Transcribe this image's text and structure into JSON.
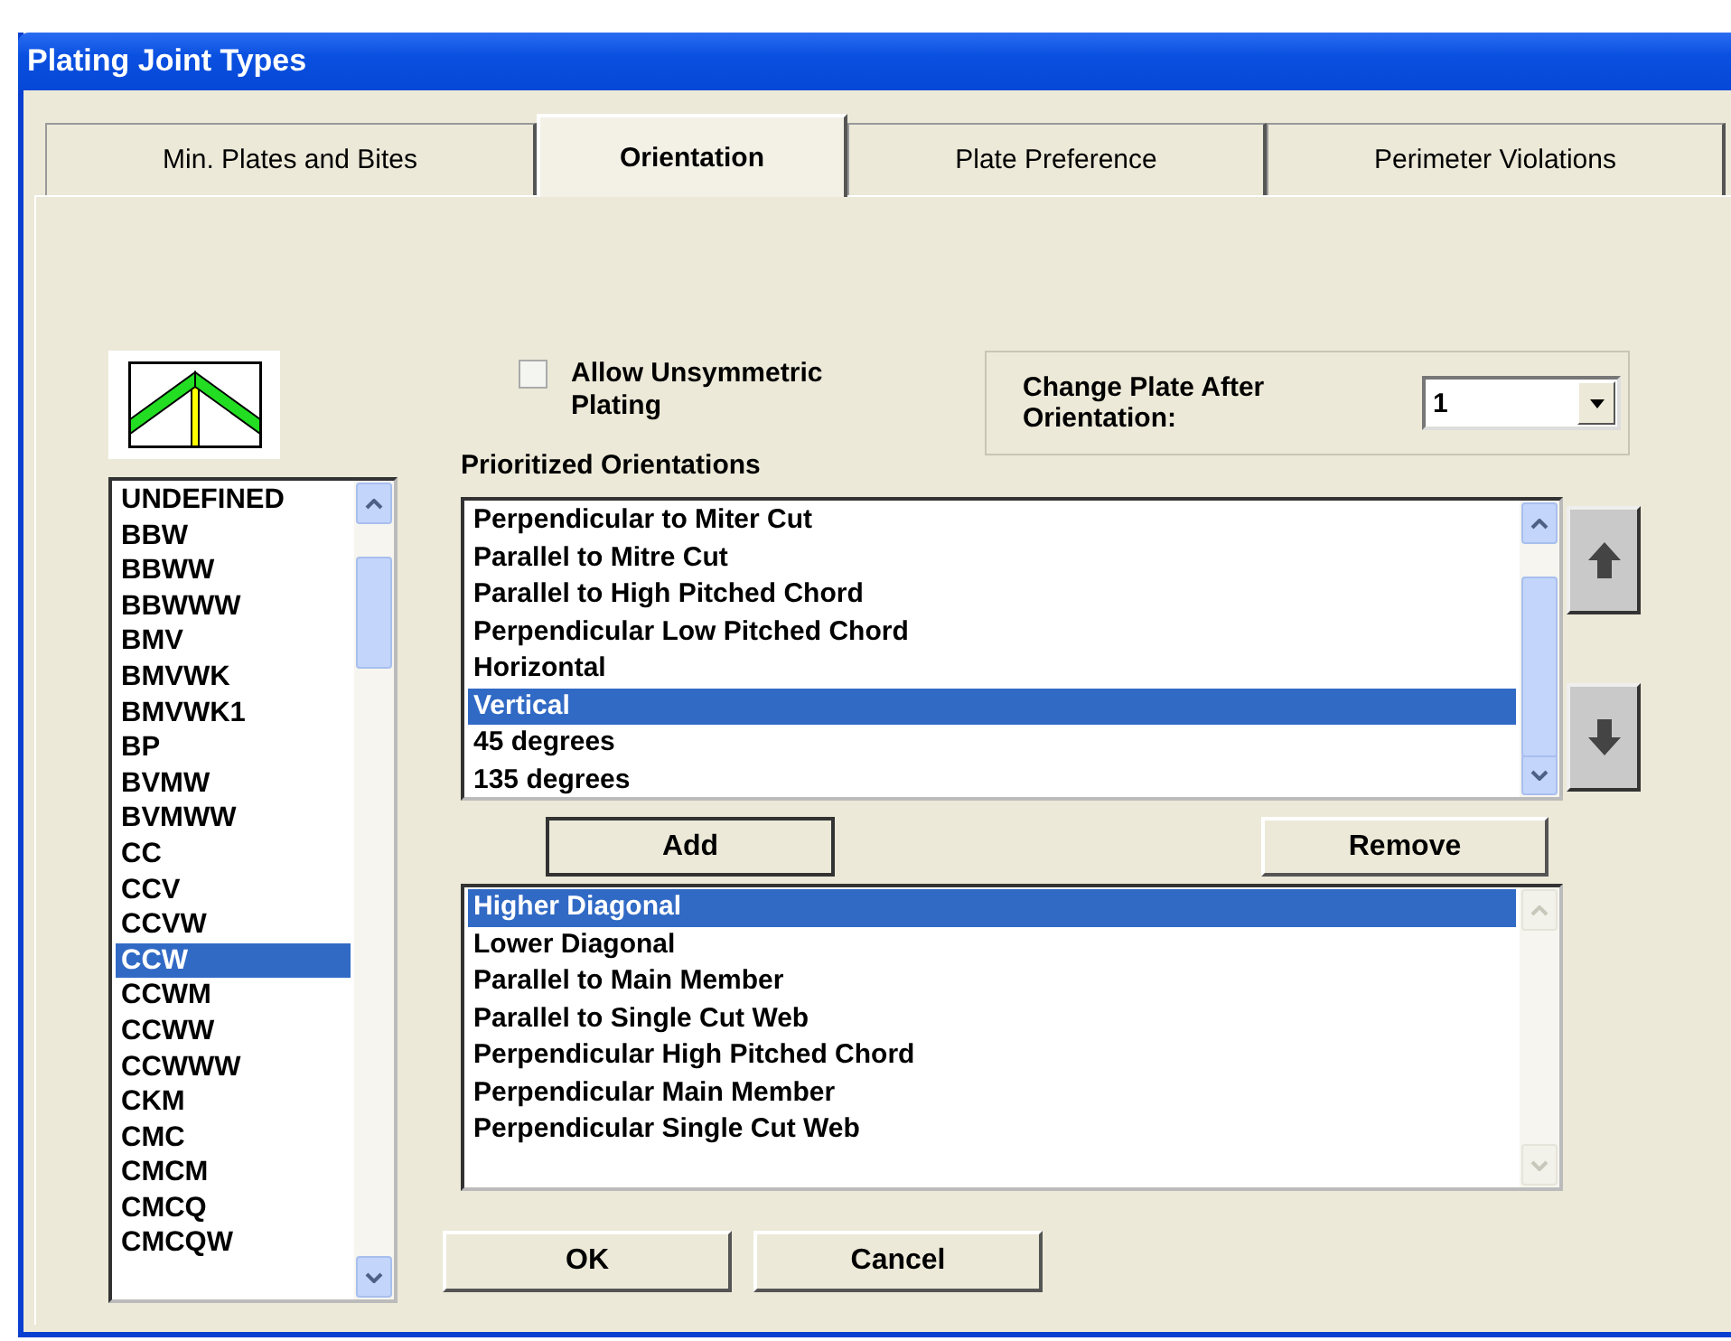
{
  "window": {
    "title": "Plating Joint Types"
  },
  "tabs": [
    {
      "label": "Min. Plates and Bites",
      "selected": false
    },
    {
      "label": "Orientation",
      "selected": true
    },
    {
      "label": "Plate Preference",
      "selected": false
    },
    {
      "label": "Perimeter Violations",
      "selected": false
    }
  ],
  "joint_types": {
    "scroll_enabled": true,
    "items": [
      {
        "label": "UNDEFINED",
        "selected": false
      },
      {
        "label": "BBW",
        "selected": false
      },
      {
        "label": "BBWW",
        "selected": false
      },
      {
        "label": "BBWWW",
        "selected": false
      },
      {
        "label": "BMV",
        "selected": false
      },
      {
        "label": "BMVWK",
        "selected": false
      },
      {
        "label": "BMVWK1",
        "selected": false
      },
      {
        "label": "BP",
        "selected": false
      },
      {
        "label": "BVMW",
        "selected": false
      },
      {
        "label": "BVMWW",
        "selected": false
      },
      {
        "label": "CC",
        "selected": false
      },
      {
        "label": "CCV",
        "selected": false
      },
      {
        "label": "CCVW",
        "selected": false
      },
      {
        "label": "CCW",
        "selected": true
      },
      {
        "label": "CCWM",
        "selected": false
      },
      {
        "label": "CCWW",
        "selected": false
      },
      {
        "label": "CCWWW",
        "selected": false
      },
      {
        "label": "CKM",
        "selected": false
      },
      {
        "label": "CMC",
        "selected": false
      },
      {
        "label": "CMCM",
        "selected": false
      },
      {
        "label": "CMCQ",
        "selected": false
      },
      {
        "label": "CMCQW",
        "selected": false
      }
    ]
  },
  "allow_unsymmetric": {
    "label": "Allow Unsymmetric Plating",
    "checked": false
  },
  "change_plate": {
    "label": "Change Plate After Orientation:",
    "value": "1"
  },
  "prioritized": {
    "label": "Prioritized Orientations",
    "scroll_enabled": true,
    "items": [
      {
        "label": "Perpendicular to Miter Cut",
        "selected": false
      },
      {
        "label": "Parallel to Mitre Cut",
        "selected": false
      },
      {
        "label": "Parallel to High Pitched Chord",
        "selected": false
      },
      {
        "label": "Perpendicular Low Pitched Chord",
        "selected": false
      },
      {
        "label": "Horizontal",
        "selected": false
      },
      {
        "label": "Vertical",
        "selected": true
      },
      {
        "label": "45 degrees",
        "selected": false
      },
      {
        "label": "135 degrees",
        "selected": false
      }
    ]
  },
  "add_button": "Add",
  "remove_button": "Remove",
  "available": {
    "scroll_enabled": false,
    "items": [
      {
        "label": "Higher Diagonal",
        "selected": true
      },
      {
        "label": "Lower Diagonal",
        "selected": false
      },
      {
        "label": "Parallel to Main Member",
        "selected": false
      },
      {
        "label": "Parallel to Single Cut Web",
        "selected": false
      },
      {
        "label": "Perpendicular High Pitched Chord",
        "selected": false
      },
      {
        "label": "Perpendicular Main Member",
        "selected": false
      },
      {
        "label": "Perpendicular Single Cut Web",
        "selected": false
      }
    ]
  },
  "ok_button": "OK",
  "cancel_button": "Cancel"
}
